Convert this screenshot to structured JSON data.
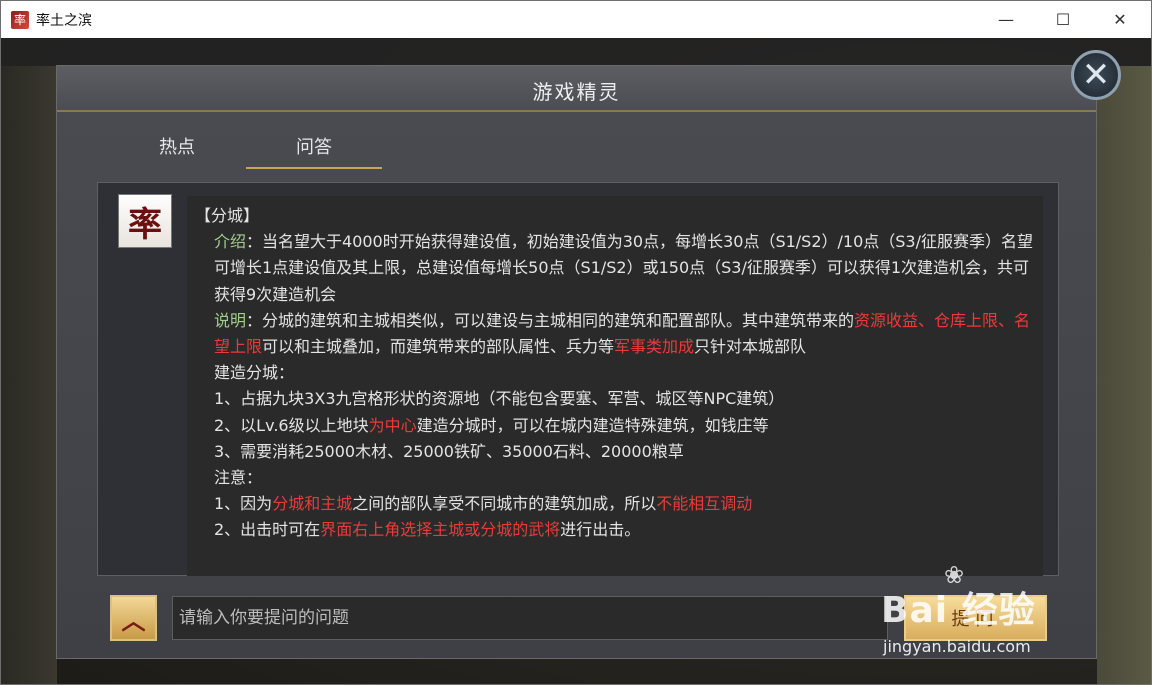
{
  "window": {
    "title": "率土之滨",
    "app_icon_glyph": "率",
    "min_glyph": "—",
    "max_glyph": "☐",
    "close_glyph": "✕"
  },
  "dialog": {
    "title": "游戏精灵",
    "close_glyph": "✕",
    "tabs": [
      {
        "label": "热点",
        "active": false
      },
      {
        "label": "问答",
        "active": true
      }
    ]
  },
  "answer": {
    "avatar_glyph": "率",
    "heading": "【分城】",
    "intro_label": "介绍",
    "intro_text": "：当名望大于4000时开始获得建设值，初始建设值为30点，每增长30点（S1/S2）/10点（S3/征服赛季）名望可增长1点建设值及其上限，总建设值每增长50点（S1/S2）或150点（S3/征服赛季）可以获得1次建造机会，共可获得9次建造机会",
    "desc_label": "说明",
    "desc_text_1": "：分城的建筑和主城相类似，可以建设与主城相同的建筑和配置部队。其中建筑带来的",
    "desc_red_1": "资源收益、仓库上限、名望上限",
    "desc_text_2": "可以和主城叠加，而建筑带来的部队属性、兵力等",
    "desc_red_2": "军事类加成",
    "desc_text_3": "只针对本城部队",
    "build_label": "建造分城：",
    "build_1": "1、占据九块3X3九宫格形状的资源地（不能包含要塞、军营、城区等NPC建筑）",
    "build_2_a": "2、以Lv.6级以上地块",
    "build_2_red": "为中心",
    "build_2_b": "建造分城时，可以在城内建造特殊建筑，如钱庄等",
    "build_3": "3、需要消耗25000木材、25000铁矿、35000石料、20000粮草",
    "note_label": "注意：",
    "note_1_a": "1、因为",
    "note_1_red": "分城和主城",
    "note_1_b": "之间的部队享受不同城市的建筑加成，所以",
    "note_1_red2": "不能相互调动",
    "note_2_a": "2、出击时可在",
    "note_2_red": "界面右上角选择主城或分城的武将",
    "note_2_b": "进行出击。"
  },
  "input": {
    "placeholder": "请输入你要提问的问题",
    "value": "",
    "expand_glyph": "︿",
    "submit_label": "提问"
  },
  "watermark": {
    "logo": "Bai 经验",
    "paw": "❀",
    "url": "jingyan.baidu.com"
  },
  "colors": {
    "highlight_red": "#ea3b3b",
    "label_green": "#9fd08b",
    "tab_underline": "#c9a556",
    "button_gold": "#d9ad5e"
  }
}
